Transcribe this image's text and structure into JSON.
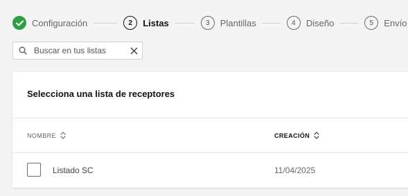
{
  "stepper": {
    "steps": [
      {
        "number": "",
        "label": "Configuración",
        "state": "done"
      },
      {
        "number": "2",
        "label": "Listas",
        "state": "active"
      },
      {
        "number": "3",
        "label": "Plantillas",
        "state": "pending"
      },
      {
        "number": "4",
        "label": "Diseño",
        "state": "pending"
      },
      {
        "number": "5",
        "label": "Envío",
        "state": "pending"
      }
    ]
  },
  "search": {
    "placeholder": "Buscar en tus listas",
    "value": ""
  },
  "card": {
    "title": "Selecciona una lista de receptores",
    "columns": [
      {
        "label": "NOMBRE",
        "sortable": true
      },
      {
        "label": "CREACIÓN",
        "sortable": true
      }
    ],
    "rows": [
      {
        "name": "Listado SC",
        "created": "11/04/2025",
        "checked": false
      }
    ]
  },
  "colors": {
    "done_green": "#2f9e44",
    "active_text": "#111111",
    "muted_text": "#666666",
    "background": "#f4f4f4"
  },
  "icons": [
    "checkmark-icon",
    "search-icon",
    "close-icon",
    "sort-icon"
  ]
}
